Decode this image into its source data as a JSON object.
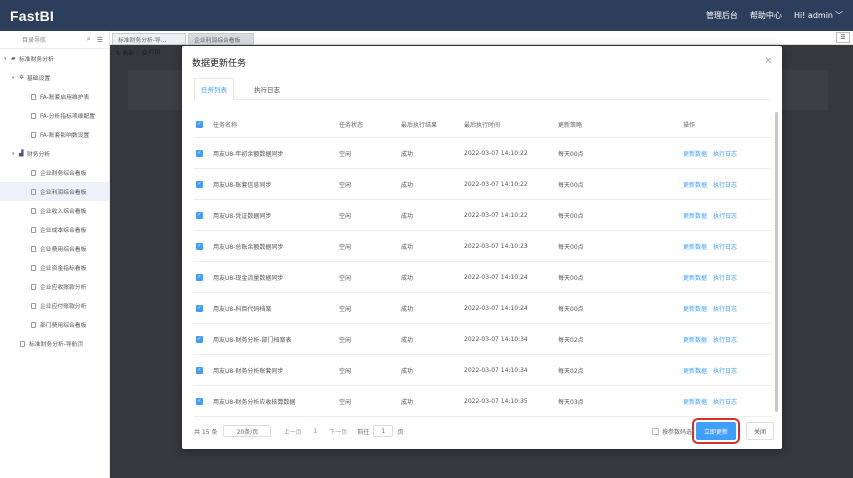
{
  "app": {
    "logo": "FastBI"
  },
  "topnav": {
    "admin": "管理后台",
    "help": "帮助中心",
    "user": "Hi! admin"
  },
  "sidebar": {
    "title": "目录导航",
    "root": "标准财务分析",
    "groups": [
      {
        "label": "基础设置",
        "items": [
          "FA-账套启用维护表",
          "FA-分析指标项维配置",
          "FA-账套影响数设置"
        ]
      },
      {
        "label": "财务分析",
        "items": [
          "企业财务综合看板",
          "企业利润综合看板",
          "企业收入综合看板",
          "企业成本综合看板",
          "企业费用综合看板",
          "企业资金指标看板",
          "企业应收账款分析",
          "企业应付账款分析",
          "部门费用综合看板"
        ]
      }
    ],
    "root2": "标准财务分析-导航页",
    "active_item": "企业利润综合看板"
  },
  "tabs": [
    "标准财务分析-导...",
    "企业利润综合看板"
  ],
  "toolbar": {
    "refresh": "刷新",
    "print": "打印"
  },
  "dialog": {
    "title": "数据更新任务",
    "tabs": [
      "任务列表",
      "执行日志"
    ],
    "columns": [
      "任务名称",
      "任务状态",
      "最后执行结果",
      "最后执行时间",
      "更新策略",
      "操作"
    ],
    "rows": [
      {
        "name": "用友U8-年初余额数据同步",
        "status": "空闲",
        "result": "成功",
        "time": "2022-03-07 14:10:22",
        "strategy": "每天00点"
      },
      {
        "name": "用友U8-账套信息同步",
        "status": "空闲",
        "result": "成功",
        "time": "2022-03-07 14:10:22",
        "strategy": "每天00点"
      },
      {
        "name": "用友U8-凭证数据同步",
        "status": "空闲",
        "result": "成功",
        "time": "2022-03-07 14:10:22",
        "strategy": "每天00点"
      },
      {
        "name": "用友U8-总账余额数据同步",
        "status": "空闲",
        "result": "成功",
        "time": "2022-03-07 14:10:23",
        "strategy": "每天00点"
      },
      {
        "name": "用友U8-现金流量数据同步",
        "status": "空闲",
        "result": "成功",
        "time": "2022-03-07 14:10:24",
        "strategy": "每天00点"
      },
      {
        "name": "用友U8-科目代码档案",
        "status": "空闲",
        "result": "成功",
        "time": "2022-03-07 14:10:24",
        "strategy": "每天00点"
      },
      {
        "name": "用友U8-财务分析-部门档案表",
        "status": "空闲",
        "result": "成功",
        "time": "2022-03-07 14:10:34",
        "strategy": "每天02点"
      },
      {
        "name": "用友U8-财务分析账套同步",
        "status": "空闲",
        "result": "成功",
        "time": "2022-03-07 14:10:34",
        "strategy": "每天02点"
      },
      {
        "name": "用友U8-财务分析应收核算数据",
        "status": "空闲",
        "result": "成功",
        "time": "2022-03-07 14:10:35",
        "strategy": "每天03点"
      }
    ],
    "ops": {
      "update": "更新数据",
      "log": "执行日志"
    },
    "footer": {
      "total": "共 15 条",
      "page_size": "20条/页",
      "prev": "上一页",
      "current": "1",
      "next": "下一页",
      "goto_prefix": "前往",
      "goto_value": "1",
      "goto_suffix": "页",
      "param_check": "按参数码选",
      "run_now": "立即更新",
      "close": "关闭"
    }
  }
}
